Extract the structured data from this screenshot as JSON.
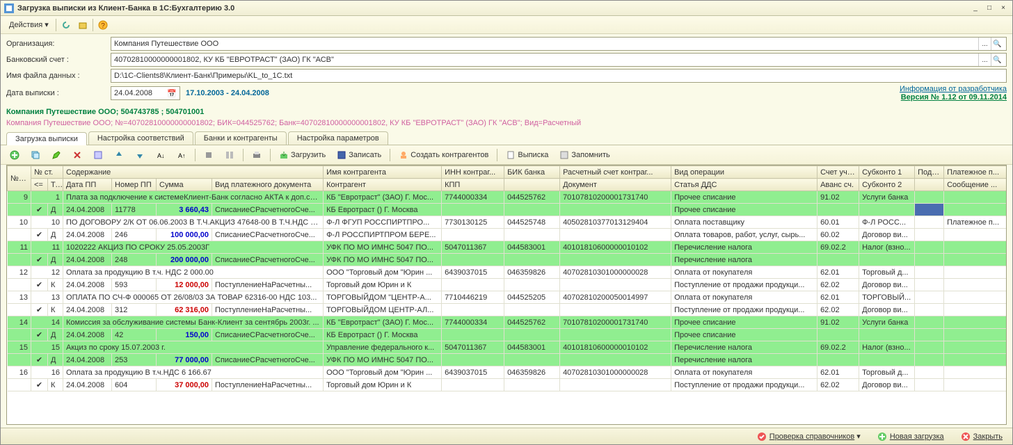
{
  "title": "Загрузка выписки из Клиент-Банка в 1С:Бухгалтерию 3.0",
  "menu": {
    "actions": "Действия"
  },
  "form": {
    "org_label": "Организация:",
    "org_value": "Компания Путешествие ООО",
    "account_label": "Банковский счет :",
    "account_value": "40702810000000001802, КУ КБ \"ЕВРОТРАСТ\" (ЗАО) ГК \"АСВ\"",
    "file_label": "Имя файла данных :",
    "file_value": "D:\\1C-Clients8\\Клиент-Банк\\Примеры\\KL_to_1C.txt",
    "date_label": "Дата выписки :",
    "date_value": "24.04.2008",
    "date_range": "17.10.2003 - 24.04.2008",
    "dev_info": "Информация от разработчика",
    "version": "Версия № 1.12 от 09.11.2014"
  },
  "info1": "Компания Путешествие ООО; 504743785 ; 504701001",
  "info2": "Компания Путешествие ООО; №=40702810000000001802; БИК=044525762; Банк=40702810000000001802, КУ КБ \"ЕВРОТРАСТ\" (ЗАО) ГК \"АСВ\"; Вид=Расчетный",
  "tabs": {
    "t1": "Загрузка выписки",
    "t2": "Настройка соответствий",
    "t3": "Банки и контрагенты",
    "t4": "Настройка параметров"
  },
  "toolbar": {
    "load": "Загрузить",
    "save": "Записать",
    "create": "Создать контрагентов",
    "report": "Выписка",
    "remember": "Запомнить"
  },
  "headers": {
    "r1": {
      "c1": "№ п/п",
      "c2": "№ ст.",
      "c3": "Содержание",
      "c4": "Имя контрагента",
      "c5": "ИНН контраг...",
      "c6": "БИК банка",
      "c7": "Расчетный счет контраг...",
      "c8": "Вид операции",
      "c9": "Счет уче...",
      "c10": "Субконто 1",
      "c11": "Подр...",
      "c12": "Платежное п..."
    },
    "r2": {
      "c1": "<=",
      "c2": "Тип",
      "c3": "Дата ПП",
      "c4": "Номер ПП",
      "c5": "Сумма",
      "c6": "Вид платежного документа",
      "c7": "Контрагент",
      "c8": "КПП",
      "c9": "",
      "c10": "Документ",
      "c11": "Статья ДДС",
      "c12": "Аванс сч.",
      "c13": "Субконто 2",
      "c14": "",
      "c15": "Сообщение ..."
    }
  },
  "rows": [
    {
      "g": 1,
      "n": "9",
      "st": "1",
      "desc": "Плата за подключение к системеКлиент-Банк согласно АКТА к доп.со...",
      "ctr": "КБ \"Евротраст\" (ЗАО) Г. Мос...",
      "inn": "7744000334",
      "bik": "044525762",
      "acct": "70107810200001731740",
      "op": "Прочее списание",
      "acc": "91.02",
      "sub": "Услуги банка",
      "pod": "",
      "pp": ""
    },
    {
      "g": 1,
      "chk": "✔",
      "tip": "Д",
      "date": "24.04.2008",
      "num": "11778",
      "amt": "3 660,43",
      "amtc": "blue",
      "doc": "СписаниеСРасчетногоСче...",
      "ctr": "КБ Евротраст () Г. Москва",
      "inn": "",
      "bik": "",
      "acct": "",
      "op": "Прочее списание",
      "acc": "",
      "sub": "",
      "pod_sel": 1
    },
    {
      "g": 0,
      "n": "10",
      "st": "10",
      "desc": "ПО ДОГОВОРУ 2/К ОТ 06.06.2003 В Т.Ч.АКЦИЗ 47648-00 В Т.Ч.НДС 2...",
      "ctr": "Ф-Л ФГУП РОССПИРТПРО...",
      "inn": "7730130125",
      "bik": "044525748",
      "acct": "40502810377013129404",
      "op": "Оплата поставщику",
      "acc": "60.01",
      "sub": "Ф-Л РОСС...",
      "pp": "Платежное п..."
    },
    {
      "g": 0,
      "chk": "✔",
      "tip": "Д",
      "date": "24.04.2008",
      "num": "246",
      "amt": "100 000,00",
      "amtc": "blue",
      "doc": "СписаниеСРасчетногоСче...",
      "ctr": "Ф-Л РОССПИРТПРОМ БЕРЕ...",
      "inn": "",
      "bik": "",
      "acct": "",
      "op": "Оплата товаров, работ, услуг, сырь...",
      "acc": "60.02",
      "sub": "Договор ви..."
    },
    {
      "g": 1,
      "n": "11",
      "st": "11",
      "desc": "1020222 АКЦИЗ ПО СРОКУ 25.05.2003Г",
      "ctr": "УФК ПО МО ИМНС 5047 ПО...",
      "inn": "5047011367",
      "bik": "044583001",
      "acct": "40101810600000010102",
      "op": "Перечисление налога",
      "acc": "69.02.2",
      "sub": "Налог (взно..."
    },
    {
      "g": 1,
      "chk": "✔",
      "tip": "Д",
      "date": "24.04.2008",
      "num": "248",
      "amt": "200 000,00",
      "amtc": "blue",
      "doc": "СписаниеСРасчетногоСче...",
      "ctr": "УФК ПО МО ИМНС 5047 ПО...",
      "inn": "",
      "bik": "",
      "acct": "",
      "op": "Перечисление налога"
    },
    {
      "g": 0,
      "n": "12",
      "st": "12",
      "desc": "Оплата за продукцию    В т.ч. НДС 2 000.00",
      "ctr": "ООО \"Торговый дом \"Юрин ...",
      "inn": "6439037015",
      "bik": "046359826",
      "acct": "40702810301000000028",
      "op": "Оплата от покупателя",
      "acc": "62.01",
      "sub": "Торговый д..."
    },
    {
      "g": 0,
      "chk": "✔",
      "tip": "К",
      "date": "24.04.2008",
      "num": "593",
      "amt": "12 000,00",
      "amtc": "red",
      "doc": "ПоступлениеНаРасчетны...",
      "ctr": "Торговый дом Юрин и К",
      "inn": "",
      "bik": "",
      "acct": "",
      "op": "Поступление от продажи продукци...",
      "acc": "62.02",
      "sub": "Договор ви..."
    },
    {
      "g": 0,
      "n": "13",
      "st": "13",
      "desc": "ОПЛАТА ПО СЧ-Ф 000065 ОТ 26/08/03 ЗА ТОВАР  62316-00 НДС 103...",
      "ctr": "ТОРГОВЫЙДОМ \"ЦЕНТР-А...",
      "inn": "7710446219",
      "bik": "044525205",
      "acct": "40702810200050014997",
      "op": "Оплата от покупателя",
      "acc": "62.01",
      "sub": "ТОРГОВЫЙ..."
    },
    {
      "g": 0,
      "chk": "✔",
      "tip": "К",
      "date": "24.04.2008",
      "num": "312",
      "amt": "62 316,00",
      "amtc": "red",
      "doc": "ПоступлениеНаРасчетны...",
      "ctr": "ТОРГОВЫЙДОМ ЦЕНТР-АЛ...",
      "inn": "",
      "bik": "",
      "acct": "",
      "op": "Поступление от продажи продукци...",
      "acc": "62.02",
      "sub": "Договор ви..."
    },
    {
      "g": 1,
      "n": "14",
      "st": "14",
      "desc": "Комиссия за обслуживание системы Банк-Клиент за сентябрь 2003г. ...",
      "ctr": "КБ \"Евротраст\" (ЗАО) Г. Мос...",
      "inn": "7744000334",
      "bik": "044525762",
      "acct": "70107810200001731740",
      "op": "Прочее списание",
      "acc": "91.02",
      "sub": "Услуги банка"
    },
    {
      "g": 1,
      "chk": "✔",
      "tip": "Д",
      "date": "24.04.2008",
      "num": "42",
      "amt": "150,00",
      "amtc": "blue",
      "doc": "СписаниеСРасчетногоСче...",
      "ctr": "КБ Евротраст () Г. Москва",
      "inn": "",
      "bik": "",
      "acct": "",
      "op": "Прочее списание"
    },
    {
      "g": 1,
      "n": "15",
      "st": "15",
      "desc": "Акциз по сроку 15.07.2003 г.",
      "ctr": "Управление федерального к...",
      "inn": "5047011367",
      "bik": "044583001",
      "acct": "40101810600000010102",
      "op": "Перечисление налога",
      "acc": "69.02.2",
      "sub": "Налог (взно..."
    },
    {
      "g": 1,
      "chk": "✔",
      "tip": "Д",
      "date": "24.04.2008",
      "num": "253",
      "amt": "77 000,00",
      "amtc": "blue",
      "doc": "СписаниеСРасчетногоСче...",
      "ctr": "УФК ПО МО ИМНС 5047 ПО...",
      "inn": "",
      "bik": "",
      "acct": "",
      "op": "Перечисление налога"
    },
    {
      "g": 0,
      "n": "16",
      "st": "16",
      "desc": "Оплата за продукцию    В т.ч.НДС 6 166.67",
      "ctr": "ООО \"Торговый дом \"Юрин ...",
      "inn": "6439037015",
      "bik": "046359826",
      "acct": "40702810301000000028",
      "op": "Оплата от покупателя",
      "acc": "62.01",
      "sub": "Торговый д..."
    },
    {
      "g": 0,
      "chk": "✔",
      "tip": "К",
      "date": "24.04.2008",
      "num": "604",
      "amt": "37 000,00",
      "amtc": "red",
      "doc": "ПоступлениеНаРасчетны...",
      "ctr": "Торговый дом Юрин и К",
      "inn": "",
      "bik": "",
      "acct": "",
      "op": "Поступление от продажи продукци...",
      "acc": "62.02",
      "sub": "Договор ви..."
    }
  ],
  "status": {
    "check": "Проверка справочников",
    "newload": "Новая загрузка",
    "close": "Закрыть"
  }
}
